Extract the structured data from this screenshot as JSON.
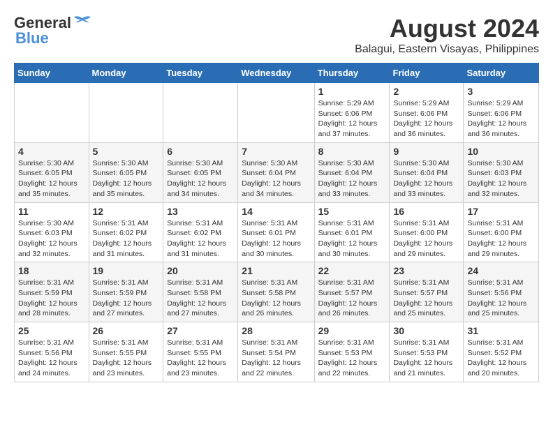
{
  "header": {
    "logo_line1": "General",
    "logo_line2": "Blue",
    "title": "August 2024",
    "subtitle": "Balagui, Eastern Visayas, Philippines"
  },
  "weekdays": [
    "Sunday",
    "Monday",
    "Tuesday",
    "Wednesday",
    "Thursday",
    "Friday",
    "Saturday"
  ],
  "weeks": [
    [
      {
        "day": "",
        "info": ""
      },
      {
        "day": "",
        "info": ""
      },
      {
        "day": "",
        "info": ""
      },
      {
        "day": "",
        "info": ""
      },
      {
        "day": "1",
        "info": "Sunrise: 5:29 AM\nSunset: 6:06 PM\nDaylight: 12 hours\nand 37 minutes."
      },
      {
        "day": "2",
        "info": "Sunrise: 5:29 AM\nSunset: 6:06 PM\nDaylight: 12 hours\nand 36 minutes."
      },
      {
        "day": "3",
        "info": "Sunrise: 5:29 AM\nSunset: 6:06 PM\nDaylight: 12 hours\nand 36 minutes."
      }
    ],
    [
      {
        "day": "4",
        "info": "Sunrise: 5:30 AM\nSunset: 6:05 PM\nDaylight: 12 hours\nand 35 minutes."
      },
      {
        "day": "5",
        "info": "Sunrise: 5:30 AM\nSunset: 6:05 PM\nDaylight: 12 hours\nand 35 minutes."
      },
      {
        "day": "6",
        "info": "Sunrise: 5:30 AM\nSunset: 6:05 PM\nDaylight: 12 hours\nand 34 minutes."
      },
      {
        "day": "7",
        "info": "Sunrise: 5:30 AM\nSunset: 6:04 PM\nDaylight: 12 hours\nand 34 minutes."
      },
      {
        "day": "8",
        "info": "Sunrise: 5:30 AM\nSunset: 6:04 PM\nDaylight: 12 hours\nand 33 minutes."
      },
      {
        "day": "9",
        "info": "Sunrise: 5:30 AM\nSunset: 6:04 PM\nDaylight: 12 hours\nand 33 minutes."
      },
      {
        "day": "10",
        "info": "Sunrise: 5:30 AM\nSunset: 6:03 PM\nDaylight: 12 hours\nand 32 minutes."
      }
    ],
    [
      {
        "day": "11",
        "info": "Sunrise: 5:30 AM\nSunset: 6:03 PM\nDaylight: 12 hours\nand 32 minutes."
      },
      {
        "day": "12",
        "info": "Sunrise: 5:31 AM\nSunset: 6:02 PM\nDaylight: 12 hours\nand 31 minutes."
      },
      {
        "day": "13",
        "info": "Sunrise: 5:31 AM\nSunset: 6:02 PM\nDaylight: 12 hours\nand 31 minutes."
      },
      {
        "day": "14",
        "info": "Sunrise: 5:31 AM\nSunset: 6:01 PM\nDaylight: 12 hours\nand 30 minutes."
      },
      {
        "day": "15",
        "info": "Sunrise: 5:31 AM\nSunset: 6:01 PM\nDaylight: 12 hours\nand 30 minutes."
      },
      {
        "day": "16",
        "info": "Sunrise: 5:31 AM\nSunset: 6:00 PM\nDaylight: 12 hours\nand 29 minutes."
      },
      {
        "day": "17",
        "info": "Sunrise: 5:31 AM\nSunset: 6:00 PM\nDaylight: 12 hours\nand 29 minutes."
      }
    ],
    [
      {
        "day": "18",
        "info": "Sunrise: 5:31 AM\nSunset: 5:59 PM\nDaylight: 12 hours\nand 28 minutes."
      },
      {
        "day": "19",
        "info": "Sunrise: 5:31 AM\nSunset: 5:59 PM\nDaylight: 12 hours\nand 27 minutes."
      },
      {
        "day": "20",
        "info": "Sunrise: 5:31 AM\nSunset: 5:58 PM\nDaylight: 12 hours\nand 27 minutes."
      },
      {
        "day": "21",
        "info": "Sunrise: 5:31 AM\nSunset: 5:58 PM\nDaylight: 12 hours\nand 26 minutes."
      },
      {
        "day": "22",
        "info": "Sunrise: 5:31 AM\nSunset: 5:57 PM\nDaylight: 12 hours\nand 26 minutes."
      },
      {
        "day": "23",
        "info": "Sunrise: 5:31 AM\nSunset: 5:57 PM\nDaylight: 12 hours\nand 25 minutes."
      },
      {
        "day": "24",
        "info": "Sunrise: 5:31 AM\nSunset: 5:56 PM\nDaylight: 12 hours\nand 25 minutes."
      }
    ],
    [
      {
        "day": "25",
        "info": "Sunrise: 5:31 AM\nSunset: 5:56 PM\nDaylight: 12 hours\nand 24 minutes."
      },
      {
        "day": "26",
        "info": "Sunrise: 5:31 AM\nSunset: 5:55 PM\nDaylight: 12 hours\nand 23 minutes."
      },
      {
        "day": "27",
        "info": "Sunrise: 5:31 AM\nSunset: 5:55 PM\nDaylight: 12 hours\nand 23 minutes."
      },
      {
        "day": "28",
        "info": "Sunrise: 5:31 AM\nSunset: 5:54 PM\nDaylight: 12 hours\nand 22 minutes."
      },
      {
        "day": "29",
        "info": "Sunrise: 5:31 AM\nSunset: 5:53 PM\nDaylight: 12 hours\nand 22 minutes."
      },
      {
        "day": "30",
        "info": "Sunrise: 5:31 AM\nSunset: 5:53 PM\nDaylight: 12 hours\nand 21 minutes."
      },
      {
        "day": "31",
        "info": "Sunrise: 5:31 AM\nSunset: 5:52 PM\nDaylight: 12 hours\nand 20 minutes."
      }
    ]
  ]
}
